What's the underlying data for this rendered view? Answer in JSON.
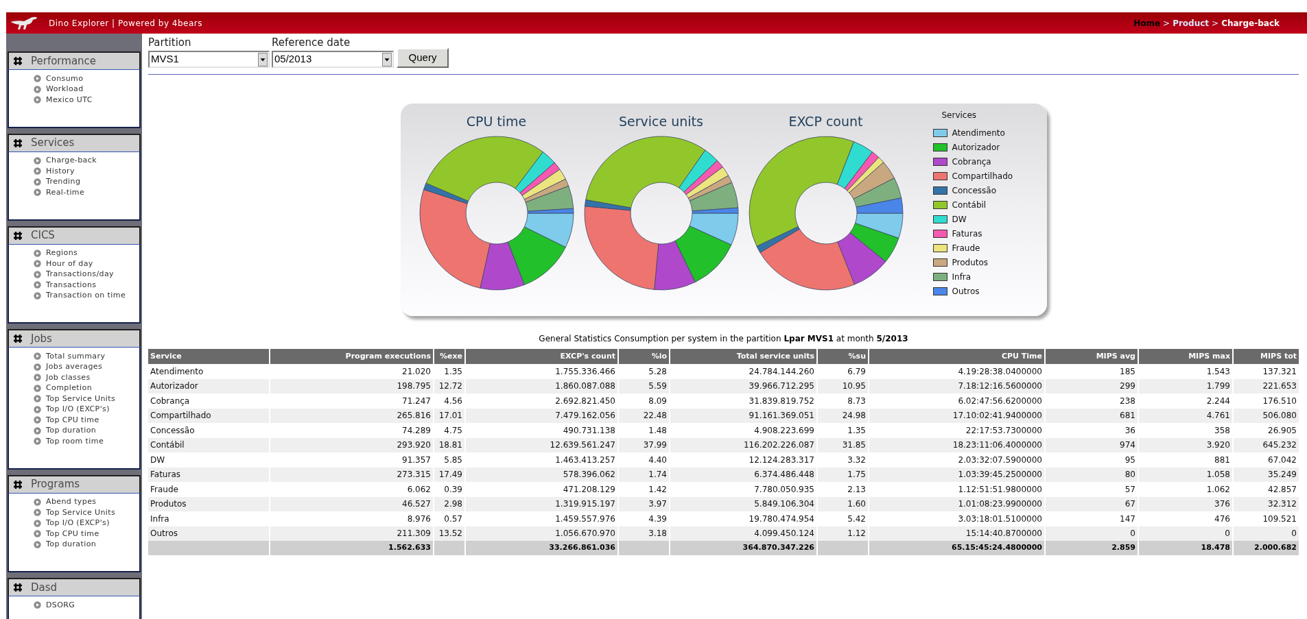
{
  "header": {
    "title": "Dino Explorer | Powered by 4bears",
    "breadcrumb": [
      {
        "kind": "home",
        "label": "Home"
      },
      {
        "kind": "separator",
        "label": ">"
      },
      {
        "kind": "link",
        "label": "Product"
      },
      {
        "kind": "separator",
        "label": ">"
      },
      {
        "kind": "current",
        "label": "Charge-back"
      }
    ]
  },
  "sidebar": [
    {
      "title": "Performance",
      "items": [
        "Consumo",
        "Workload",
        "Mexico UTC"
      ]
    },
    {
      "title": "Services",
      "items": [
        "Charge-back",
        "History",
        "Trending",
        "Real-time"
      ]
    },
    {
      "title": "CICS",
      "items": [
        "Regions",
        "Hour of day",
        "Transactions/day",
        "Transactions",
        "Transaction on time"
      ]
    },
    {
      "title": "Jobs",
      "items": [
        "Total summary",
        "Jobs averages",
        "Job classes",
        "Completion",
        "Top Service Units",
        "Top I/O (EXCP's)",
        "Top CPU time",
        "Top duration",
        "Top room time"
      ]
    },
    {
      "title": "Programs",
      "items": [
        "Abend types",
        "Top Service Units",
        "Top I/O (EXCP's)",
        "Top CPU time",
        "Top duration"
      ]
    },
    {
      "title": "Dasd",
      "items": [
        "DSORG"
      ]
    }
  ],
  "filters": {
    "partition": {
      "label": "Partition",
      "value": "MVS1"
    },
    "reference_date": {
      "label": "Reference date",
      "value": "05/2013"
    },
    "query_button": "Query"
  },
  "charts": {
    "titles": [
      "CPU time",
      "Service units",
      "EXCP count"
    ],
    "legend": {
      "title": "Services",
      "items": [
        {
          "label": "Atendimento",
          "color": "#7ecbec"
        },
        {
          "label": "Autorizador",
          "color": "#22c02a"
        },
        {
          "label": "Cobrança",
          "color": "#b048cc"
        },
        {
          "label": "Compartilhado",
          "color": "#ee7470"
        },
        {
          "label": "Concessão",
          "color": "#3473a8"
        },
        {
          "label": "Contábil",
          "color": "#92c72c"
        },
        {
          "label": "DW",
          "color": "#30dcd0"
        },
        {
          "label": "Faturas",
          "color": "#f65ab0"
        },
        {
          "label": "Fraude",
          "color": "#ece47e"
        },
        {
          "label": "Produtos",
          "color": "#c9a880"
        },
        {
          "label": "Infra",
          "color": "#7eb07f"
        },
        {
          "label": "Outros",
          "color": "#4a86e8"
        }
      ]
    }
  },
  "caption": "General Statistics Consumption per system in the partition **Lpar MVS1** at month **5/2013**",
  "table": {
    "columns": [
      "Service",
      "Program executions",
      "%exe",
      "EXCP's count",
      "%io",
      "Total service units",
      "%su",
      "CPU Time",
      "MIPS avg",
      "MIPS max",
      "MIPS tot"
    ],
    "rows": [
      [
        "Atendimento",
        "21.020",
        "1.35",
        "1.755.336.466",
        "5.28",
        "24.784.144.260",
        "6.79",
        "4.19:28:38.0400000",
        "185",
        "1.543",
        "137.321"
      ],
      [
        "Autorizador",
        "198.795",
        "12.72",
        "1.860.087.088",
        "5.59",
        "39.966.712.295",
        "10.95",
        "7.18:12:16.5600000",
        "299",
        "1.799",
        "221.653"
      ],
      [
        "Cobrança",
        "71.247",
        "4.56",
        "2.692.821.450",
        "8.09",
        "31.839.819.752",
        "8.73",
        "6.02:47:56.6200000",
        "238",
        "2.244",
        "176.510"
      ],
      [
        "Compartilhado",
        "265.816",
        "17.01",
        "7.479.162.056",
        "22.48",
        "91.161.369.051",
        "24.98",
        "17.10:02:41.9400000",
        "681",
        "4.761",
        "506.080"
      ],
      [
        "Concessão",
        "74.289",
        "4.75",
        "490.731.138",
        "1.48",
        "4.908.223.699",
        "1.35",
        "22:17:53.7300000",
        "36",
        "358",
        "26.905"
      ],
      [
        "Contábil",
        "293.920",
        "18.81",
        "12.639.561.247",
        "37.99",
        "116.202.226.087",
        "31.85",
        "18.23:11:06.4000000",
        "974",
        "3.920",
        "645.232"
      ],
      [
        "DW",
        "91.357",
        "5.85",
        "1.463.413.257",
        "4.40",
        "12.124.283.317",
        "3.32",
        "2.03:32:07.5900000",
        "95",
        "881",
        "67.042"
      ],
      [
        "Faturas",
        "273.315",
        "17.49",
        "578.396.062",
        "1.74",
        "6.374.486.448",
        "1.75",
        "1.03:39:45.2500000",
        "80",
        "1.058",
        "35.249"
      ],
      [
        "Fraude",
        "6.062",
        "0.39",
        "471.208.129",
        "1.42",
        "7.780.050.935",
        "2.13",
        "1.12:51:51.9800000",
        "57",
        "1.062",
        "42.857"
      ],
      [
        "Produtos",
        "46.527",
        "2.98",
        "1.319.915.197",
        "3.97",
        "5.849.106.304",
        "1.60",
        "1.01:08:23.9900000",
        "67",
        "376",
        "32.312"
      ],
      [
        "Infra",
        "8.976",
        "0.57",
        "1.459.557.976",
        "4.39",
        "19.780.474.954",
        "5.42",
        "3.03:18:01.5100000",
        "147",
        "476",
        "109.521"
      ],
      [
        "Outros",
        "211.309",
        "13.52",
        "1.056.670.970",
        "3.18",
        "4.099.450.124",
        "1.12",
        "15:14:40.8700000",
        "0",
        "0",
        "0"
      ]
    ],
    "totals": {
      "program_executions": "1.562.633",
      "excps_count": "33.266.861.036",
      "total_service_units": "364.870.347.226",
      "cpu_time": "65.15:45:24.4800000",
      "mips_avg": "2.859",
      "mips_max": "18.478",
      "mips_tot": "2.000.682"
    }
  }
}
